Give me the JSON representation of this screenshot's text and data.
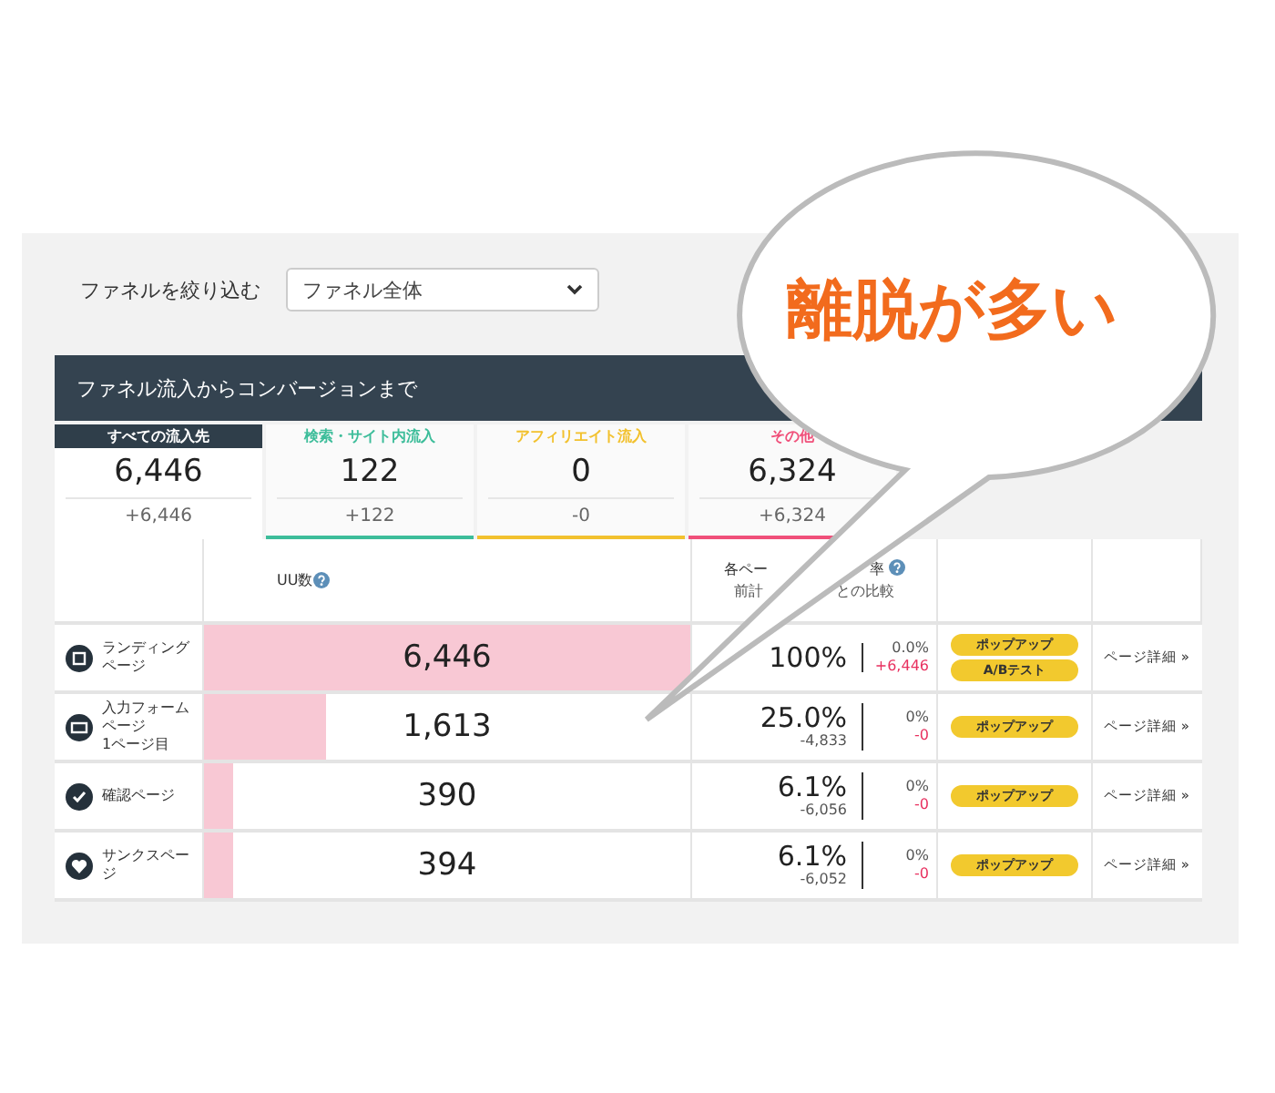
{
  "filter": {
    "label": "ファネルを絞り込む",
    "value": "ファネル全体"
  },
  "section_title": "ファネル流入からコンバージョンまで",
  "tabs": [
    {
      "label": "すべての流入先",
      "value": "6,446",
      "delta": "+6,446",
      "color": "#2f3e4a",
      "selected": true
    },
    {
      "label": "検索・サイト内流入",
      "value": "122",
      "delta": "+122",
      "color": "#3dbd9a",
      "selected": false
    },
    {
      "label": "アフィリエイト流入",
      "value": "0",
      "delta": "-0",
      "color": "#f2c12e",
      "selected": false
    },
    {
      "label": "その他",
      "value": "6,324",
      "delta": "+6,324",
      "color": "#f0507a",
      "selected": false
    }
  ],
  "table": {
    "uu_header": "UU数",
    "rate_header": "各ペー",
    "rate_header_tail": "率",
    "rate_subheader": "前計",
    "rate_subheader_tail": "との比較",
    "rows": [
      {
        "kind": "landing",
        "label": "ランディングページ",
        "level": 1,
        "value": "6,446",
        "rate": "100%",
        "rate_delta": "",
        "compare_rate": "0.0%",
        "compare_delta": "+6,446",
        "buttons": [
          "ポップアップ",
          "A/Bテスト"
        ],
        "detail": "ページ詳細 »"
      },
      {
        "kind": "form",
        "label": "入力フォームページ\n1ページ目",
        "level": 0.25,
        "value": "1,613",
        "rate": "25.0%",
        "rate_delta": "-4,833",
        "compare_rate": "0%",
        "compare_delta": "-0",
        "buttons": [
          "ポップアップ"
        ],
        "detail": "ページ詳細 »"
      },
      {
        "kind": "check",
        "label": "確認ページ",
        "level": 0.06,
        "value": "390",
        "rate": "6.1%",
        "rate_delta": "-6,056",
        "compare_rate": "0%",
        "compare_delta": "-0",
        "buttons": [
          "ポップアップ"
        ],
        "detail": "ページ詳細 »"
      },
      {
        "kind": "heart",
        "label": "サンクスページ",
        "level": 0.06,
        "value": "394",
        "rate": "6.1%",
        "rate_delta": "-6,052",
        "compare_rate": "0%",
        "compare_delta": "-0",
        "buttons": [
          "ポップアップ"
        ],
        "detail": "ページ詳細 »"
      }
    ]
  },
  "callout": {
    "text": "離脱が多い"
  }
}
